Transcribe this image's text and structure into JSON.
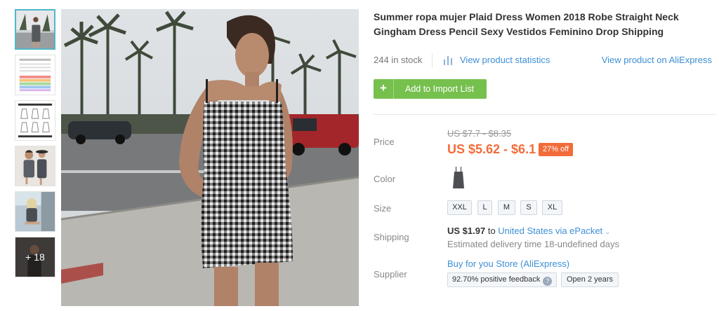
{
  "gallery": {
    "more_count_label": "+ 18"
  },
  "product": {
    "title": "Summer ropa mujer Plaid Dress Women 2018 Robe Straight Neck Gingham Dress Pencil Sexy Vestidos Feminino Drop Shipping",
    "stock": "244 in stock",
    "stats_link": "View product statistics",
    "aliexpress_link": "View product on AliExpress",
    "import_button": "Add to Import List",
    "import_icon": "+"
  },
  "details": {
    "price_label": "Price",
    "old_price": "US $7.7 - $8.35",
    "new_price": "US $5.62 - $6.1",
    "discount": "27% off",
    "color_label": "Color",
    "size_label": "Size",
    "sizes": [
      "XXL",
      "L",
      "M",
      "S",
      "XL"
    ],
    "shipping_label": "Shipping",
    "shipping_price": "US $1.97",
    "shipping_to": "to",
    "shipping_dest": "United States via ePacket",
    "delivery": "Estimated delivery time 18-undefined days",
    "supplier_label": "Supplier",
    "store": "Buy for you Store (AliExpress)",
    "feedback": "92.70% positive feedback",
    "feedback_help": "?",
    "open_years": "Open 2 years"
  },
  "colors": {
    "accent_green": "#76c04e",
    "link_blue": "#3d8fd6",
    "price_orange": "#f26c3a",
    "thumb_active_border": "#4fb7c6"
  }
}
